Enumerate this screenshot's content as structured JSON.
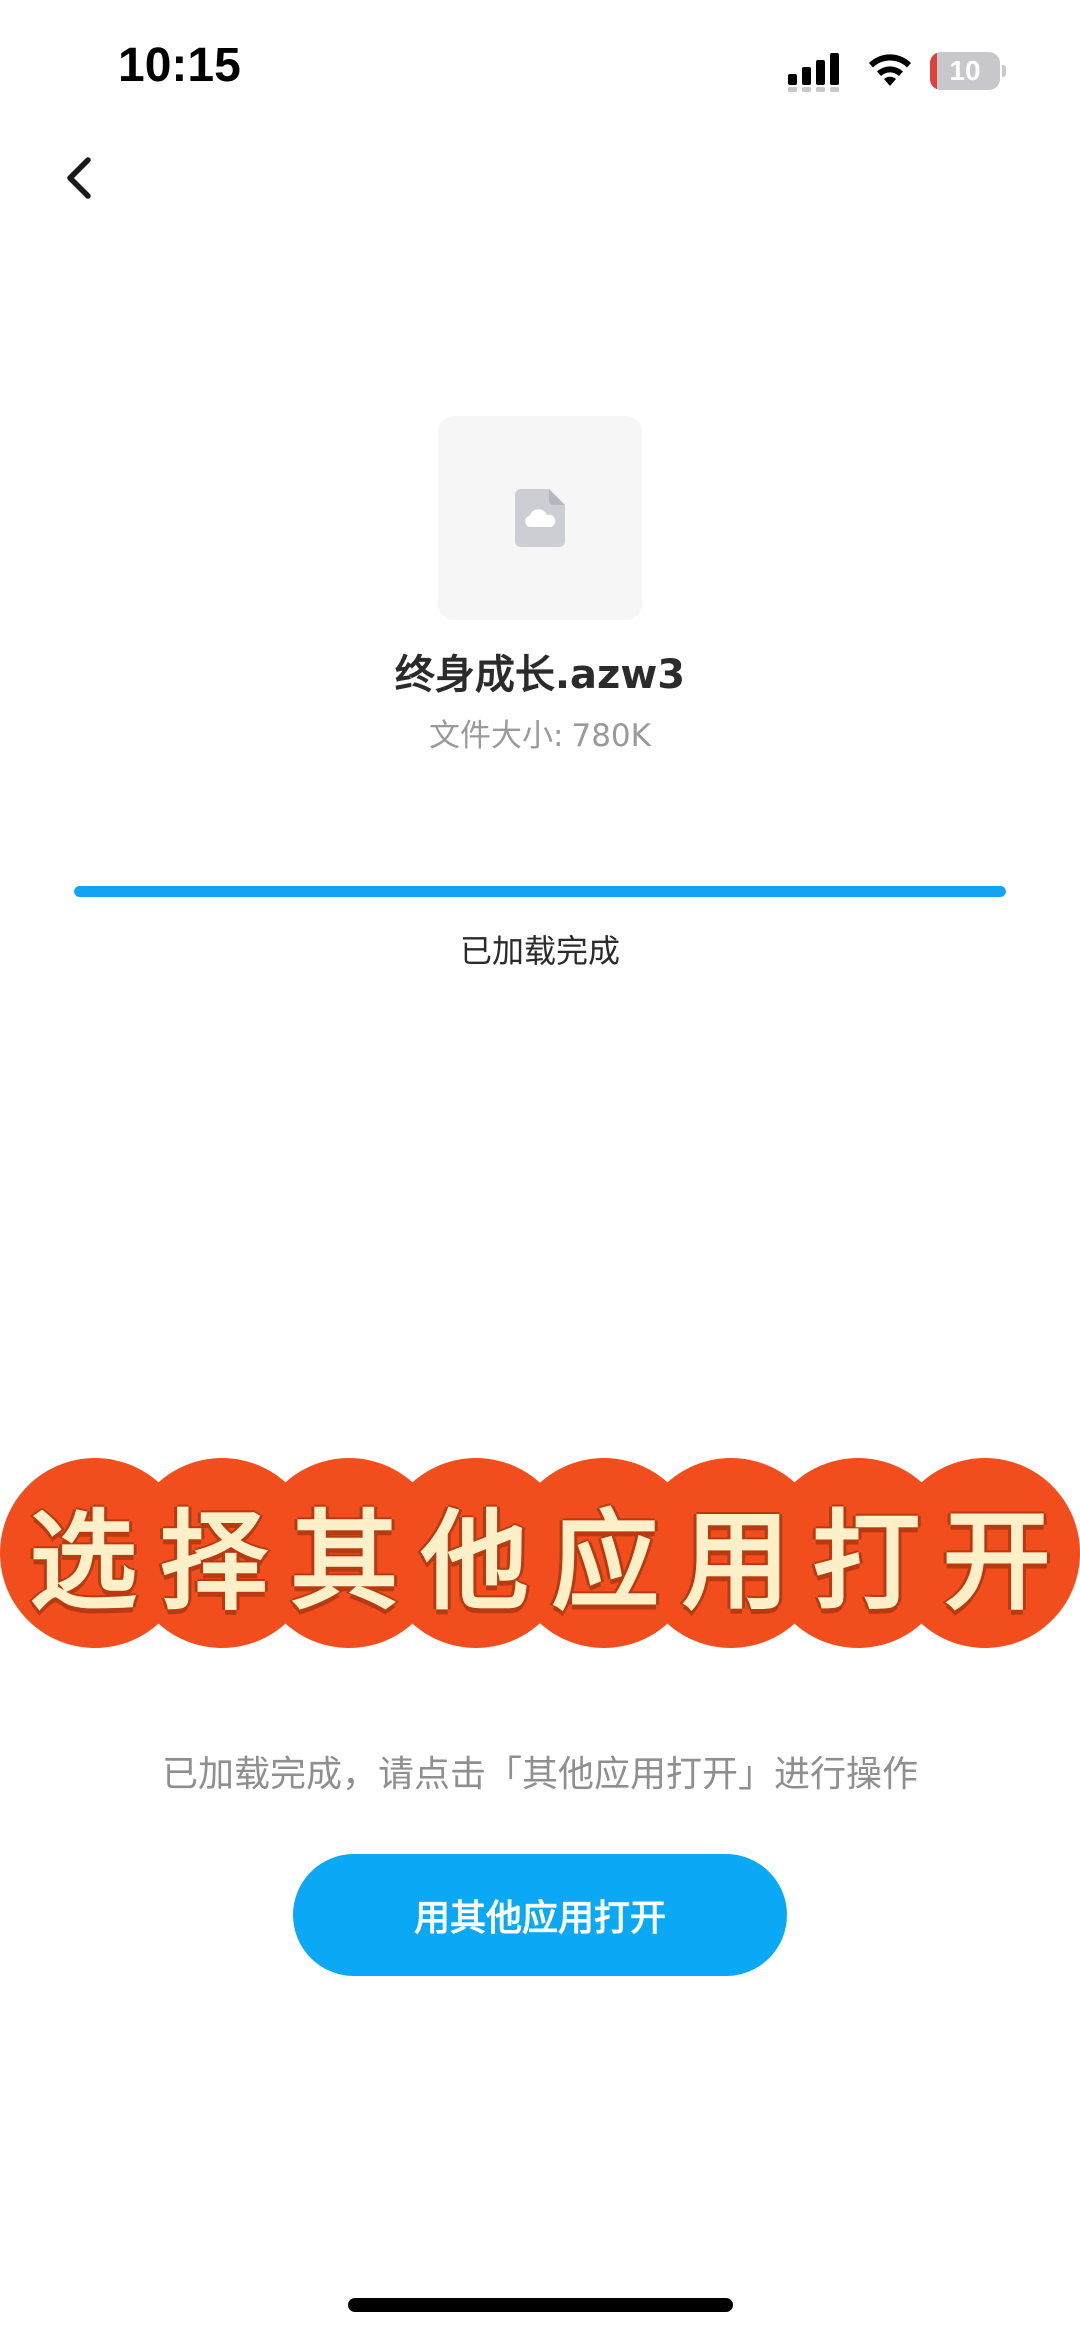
{
  "status_bar": {
    "time": "10:15",
    "battery_level": "10",
    "battery_fraction": 0.1,
    "signal_icon": "cellular-signal-icon",
    "wifi_icon": "wifi-icon"
  },
  "nav": {
    "back_icon": "chevron-left-icon"
  },
  "file": {
    "icon": "cloud-file-icon",
    "name": "终身成长.azw3",
    "size_label": "文件大小:",
    "size_value": "780K"
  },
  "progress": {
    "fraction": 1.0,
    "status": "已加载完成"
  },
  "promo_banner": {
    "chars": [
      "选",
      "择",
      "其",
      "他",
      "应",
      "用",
      "打",
      "开"
    ]
  },
  "hint": "已加载完成，请点击「其他应用打开」进行操作",
  "open_button": {
    "label": "用其他应用打开"
  },
  "colors": {
    "accent": "#0aa8f5",
    "progress": "#12a4f2",
    "banner": "#f24d1d",
    "banner_text": "#fdf0c9",
    "battery_low": "#e0413a"
  }
}
